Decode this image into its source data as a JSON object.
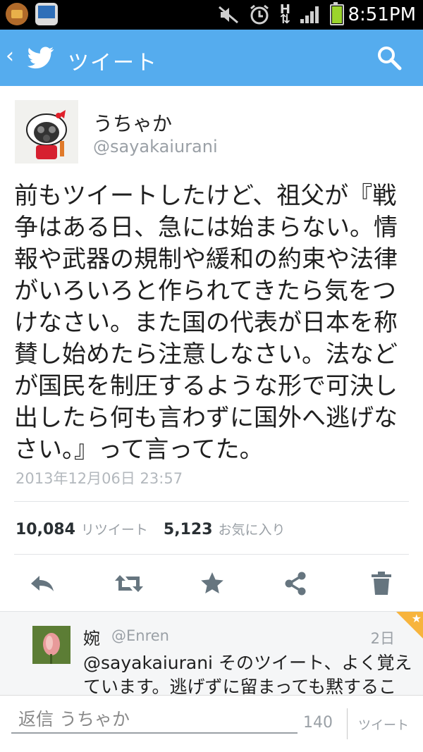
{
  "status_bar": {
    "time": "8:51PM",
    "network": "H"
  },
  "header": {
    "title": "ツイート"
  },
  "tweet": {
    "name": "うちゃか",
    "handle": "@sayakaiurani",
    "text": "前もツイートしたけど、祖父が『戦争はある日、急には始まらない。情報や武器の規制や緩和の約束や法律がいろいろと作られてきたら気をつけなさい。また国の代表が日本を称賛し始めたら注意しなさい。法などが国民を制圧するような形で可決し出したら何も言わずに国外へ逃げなさい。』って言ってた。",
    "timestamp": "2013年12月06日 23:57",
    "retweet_count": "10,084",
    "retweet_label": "リツイート",
    "favorite_count": "5,123",
    "favorite_label": "お気に入り"
  },
  "reply": {
    "name": "婉",
    "handle": "@Enren",
    "time": "2日",
    "text": "@sayakaiurani そのツイート、よく覚えています。逃げずに留まっても黙するこ"
  },
  "compose": {
    "placeholder": "返信 うちゃか",
    "char_count": "140",
    "send_label": "ツイート"
  },
  "colors": {
    "header": "#55acee",
    "status_bar": "#000000",
    "icon": "#66757f",
    "battery": "#9bd42d",
    "corner": "#f7b43d"
  }
}
